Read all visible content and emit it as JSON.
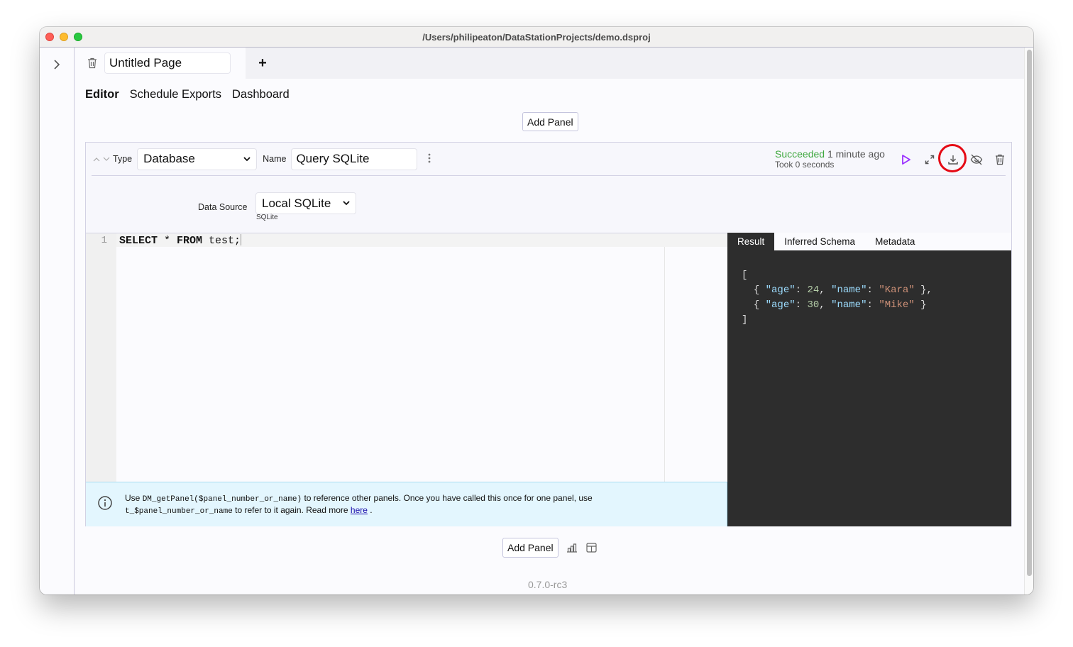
{
  "window": {
    "title": "/Users/philipeaton/DataStationProjects/demo.dsproj"
  },
  "sidebar": {
    "toggle_icon": "chevron-right-icon"
  },
  "page_tabs": {
    "delete_icon": "trash-icon",
    "page_name": "Untitled Page",
    "add_page_label": "+"
  },
  "mode_tabs": [
    {
      "label": "Editor",
      "active": true
    },
    {
      "label": "Schedule Exports",
      "active": false
    },
    {
      "label": "Dashboard",
      "active": false
    }
  ],
  "add_panel_top_label": "Add Panel",
  "panel": {
    "type_label": "Type",
    "type_value": "Database",
    "name_label": "Name",
    "name_value": "Query SQLite",
    "status_state": "Succeeded",
    "status_ago": "1 minute ago",
    "status_took": "Took 0 seconds",
    "actions": [
      "play-icon",
      "expand-icon",
      "download-icon",
      "hide-icon",
      "trash-icon"
    ],
    "highlighted_action": "download-icon",
    "data_source_label": "Data Source",
    "data_source_value": "Local SQLite",
    "data_source_sub": "SQLite",
    "editor": {
      "line_number": "1",
      "kw1": "SELECT",
      "star": " * ",
      "kw2": "FROM",
      "rest": " test;"
    },
    "hint": {
      "t1": "Use ",
      "c1": "DM_getPanel($panel_number_or_name)",
      "t2": " to reference other panels. Once you have called this once for one panel, use",
      "c2": "t_$panel_number_or_name",
      "t3": " to refer to it again. Read more ",
      "link": "here",
      "t4": " ."
    },
    "result_tabs": [
      {
        "label": "Result",
        "active": true
      },
      {
        "label": "Inferred Schema",
        "active": false
      },
      {
        "label": "Metadata",
        "active": false
      }
    ],
    "result_rows": [
      {
        "age": "24",
        "name": "\"Kara\"",
        "suffix": " },"
      },
      {
        "age": "30",
        "name": "\"Mike\"",
        "suffix": " }"
      }
    ]
  },
  "bottom": {
    "add_panel_label": "Add Panel",
    "icons": [
      "bar-chart-icon",
      "table-icon"
    ],
    "version": "0.7.0-rc3"
  },
  "colors": {
    "success": "#3fa83f",
    "run_accent": "#9b30ff",
    "highlight_ring": "#e50914",
    "result_bg": "#2d2d2d"
  }
}
